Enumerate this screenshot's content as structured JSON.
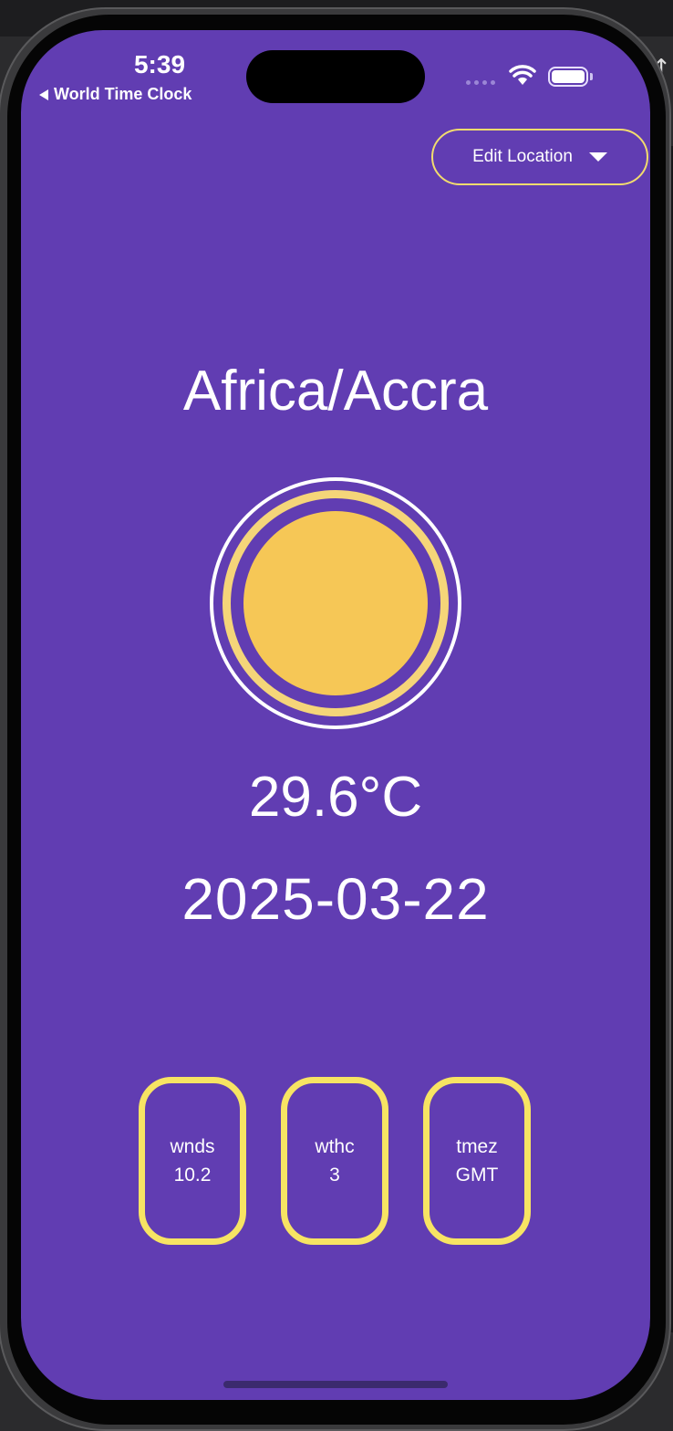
{
  "status_bar": {
    "time": "5:39",
    "back_label": "World Time Clock"
  },
  "header": {
    "edit_location_label": "Edit Location"
  },
  "main": {
    "location": "Africa/Accra",
    "temperature": "29.6°C",
    "date": "2025-03-22"
  },
  "stats": [
    {
      "label": "wnds",
      "value": "10.2"
    },
    {
      "label": "wthc",
      "value": "3"
    },
    {
      "label": "tmez",
      "value": "GMT"
    }
  ],
  "colors": {
    "background": "#613db2",
    "accent_border": "#f7e463",
    "sun": "#f6c756"
  },
  "icons": {
    "dropdown": "caret-down-icon",
    "weather": "sun-icon",
    "wifi": "wifi-icon",
    "battery": "battery-icon"
  }
}
